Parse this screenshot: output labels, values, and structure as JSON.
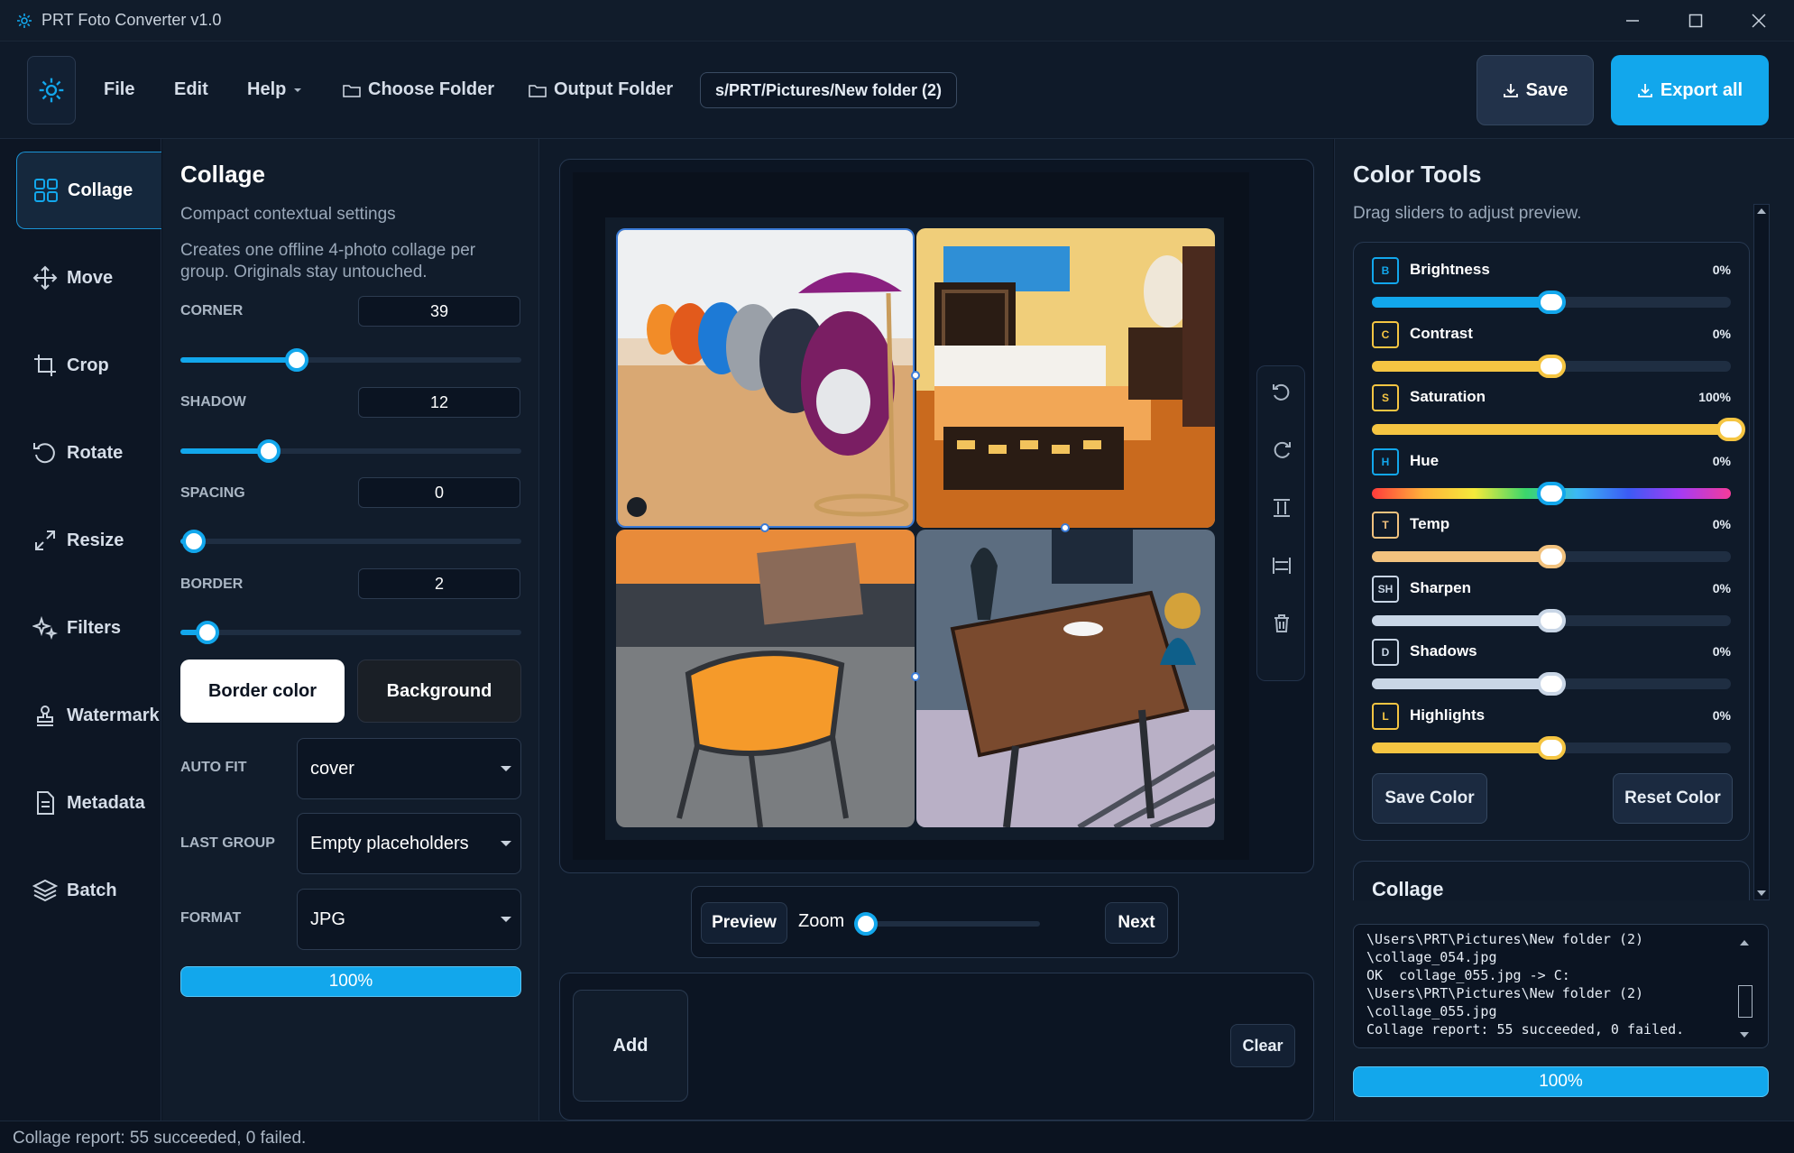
{
  "window": {
    "title": "PRT Foto Converter v1.0"
  },
  "header": {
    "menu": [
      "File",
      "Edit",
      "Help"
    ],
    "choose_folder": "Choose Folder",
    "output_folder": "Output Folder",
    "path": "s/PRT/Pictures/New folder (2)",
    "save": "Save",
    "export_all": "Export all"
  },
  "nav": {
    "items": [
      "Collage",
      "Move",
      "Crop",
      "Rotate",
      "Resize",
      "Filters",
      "Watermark",
      "Metadata",
      "Batch"
    ],
    "active": "Collage"
  },
  "settings": {
    "title": "Collage",
    "subtitle": "Compact contextual settings",
    "description": "Creates one offline 4-photo collage per group. Originals stay untouched.",
    "corner_label": "CORNER",
    "corner_value": "39",
    "corner_level": 0.34,
    "shadow_label": "SHADOW",
    "shadow_value": "12",
    "shadow_level": 0.26,
    "spacing_label": "SPACING",
    "spacing_value": "0",
    "spacing_level": 0.04,
    "border_label": "BORDER",
    "border_value": "2",
    "border_level": 0.08,
    "border_color_btn": "Border color",
    "background_btn": "Background",
    "auto_fit_label": "AUTO FIT",
    "auto_fit_value": "cover",
    "last_group_label": "LAST GROUP",
    "last_group_value": "Empty placeholders",
    "format_label": "FORMAT",
    "format_value": "JPG",
    "progress": "100%"
  },
  "preview": {
    "preview_btn": "Preview",
    "zoom_label": "Zoom",
    "next_btn": "Next",
    "add_btn": "Add",
    "clear_btn": "Clear",
    "tools": [
      "rotate-left-icon",
      "rotate-right-icon",
      "flip-vertical-icon",
      "flip-horizontal-icon",
      "trash-icon"
    ]
  },
  "color_tools": {
    "title": "Color Tools",
    "subtitle": "Drag sliders to adjust preview.",
    "rows": [
      {
        "code": "B",
        "name": "Brightness",
        "value": "0%",
        "level": 0.5,
        "color": "#12a7ec"
      },
      {
        "code": "C",
        "name": "Contrast",
        "value": "0%",
        "level": 0.5,
        "color": "#f5c542"
      },
      {
        "code": "S",
        "name": "Saturation",
        "value": "100%",
        "level": 1.0,
        "color": "#f5c542"
      },
      {
        "code": "H",
        "name": "Hue",
        "value": "0%",
        "level": 0.5,
        "color": "#12a7ec"
      },
      {
        "code": "T",
        "name": "Temp",
        "value": "0%",
        "level": 0.5,
        "color": "#f2c27e"
      },
      {
        "code": "SH",
        "name": "Sharpen",
        "value": "0%",
        "level": 0.5,
        "color": "#c9d6e6"
      },
      {
        "code": "D",
        "name": "Shadows",
        "value": "0%",
        "level": 0.5,
        "color": "#c9d6e6"
      },
      {
        "code": "L",
        "name": "Highlights",
        "value": "0%",
        "level": 0.5,
        "color": "#f5c542"
      }
    ],
    "save_color": "Save Color",
    "reset_color": "Reset Color",
    "collage_section": "Collage",
    "log": "\\Users\\PRT\\Pictures\\New folder (2)\n\\collage_054.jpg\nOK  collage_055.jpg -> C:\n\\Users\\PRT\\Pictures\\New folder (2)\n\\collage_055.jpg\nCollage report: 55 succeeded, 0 failed.",
    "progress": "100%"
  },
  "status": {
    "text": "Collage report: 55 succeeded, 0 failed."
  }
}
